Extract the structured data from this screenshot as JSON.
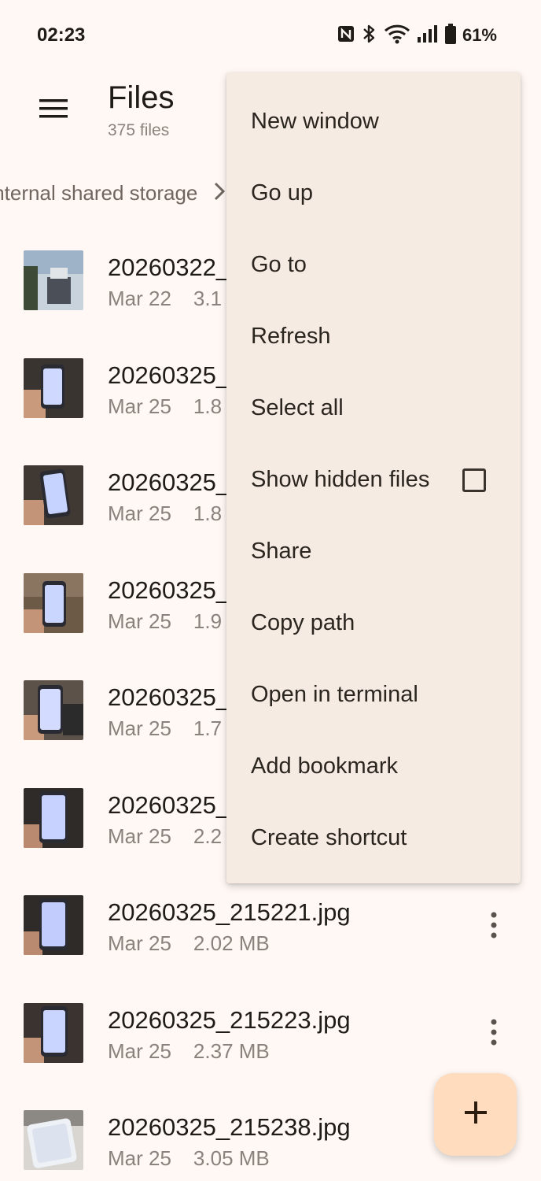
{
  "status_bar": {
    "time": "02:23",
    "battery": "61%",
    "icons": [
      "nfc-icon",
      "bluetooth-icon",
      "wifi-icon",
      "signal-icon",
      "battery-icon"
    ]
  },
  "app_bar": {
    "title": "Files",
    "subtitle": "375 files"
  },
  "breadcrumb": {
    "path": "Internal shared storage"
  },
  "files": [
    {
      "name": "20260322_",
      "date": "Mar 22",
      "size": "3.1"
    },
    {
      "name": "20260325_",
      "date": "Mar 25",
      "size": "1.8"
    },
    {
      "name": "20260325_",
      "date": "Mar 25",
      "size": "1.8"
    },
    {
      "name": "20260325_",
      "date": "Mar 25",
      "size": "1.9"
    },
    {
      "name": "20260325_",
      "date": "Mar 25",
      "size": "1.7"
    },
    {
      "name": "20260325_",
      "date": "Mar 25",
      "size": "2.2"
    },
    {
      "name": "20260325_215221.jpg",
      "date": "Mar 25",
      "size": "2.02 MB"
    },
    {
      "name": "20260325_215223.jpg",
      "date": "Mar 25",
      "size": "2.37 MB"
    },
    {
      "name": "20260325_215238.jpg",
      "date": "Mar 25",
      "size": "3.05 MB"
    }
  ],
  "overflow_menu": {
    "items": [
      {
        "label": "New window"
      },
      {
        "label": "Go up"
      },
      {
        "label": "Go to"
      },
      {
        "label": "Refresh"
      },
      {
        "label": "Select all"
      },
      {
        "label": "Show hidden files",
        "checked": false
      },
      {
        "label": "Share"
      },
      {
        "label": "Copy path"
      },
      {
        "label": "Open in terminal"
      },
      {
        "label": "Add bookmark"
      },
      {
        "label": "Create shortcut"
      }
    ]
  },
  "fab": {
    "icon": "add-icon"
  },
  "colors": {
    "background": "#fff8f4",
    "menu_surface": "#f6ebe2",
    "fab": "#ffdcbe",
    "text_primary": "#1f1b16",
    "text_secondary": "#8a837d"
  }
}
